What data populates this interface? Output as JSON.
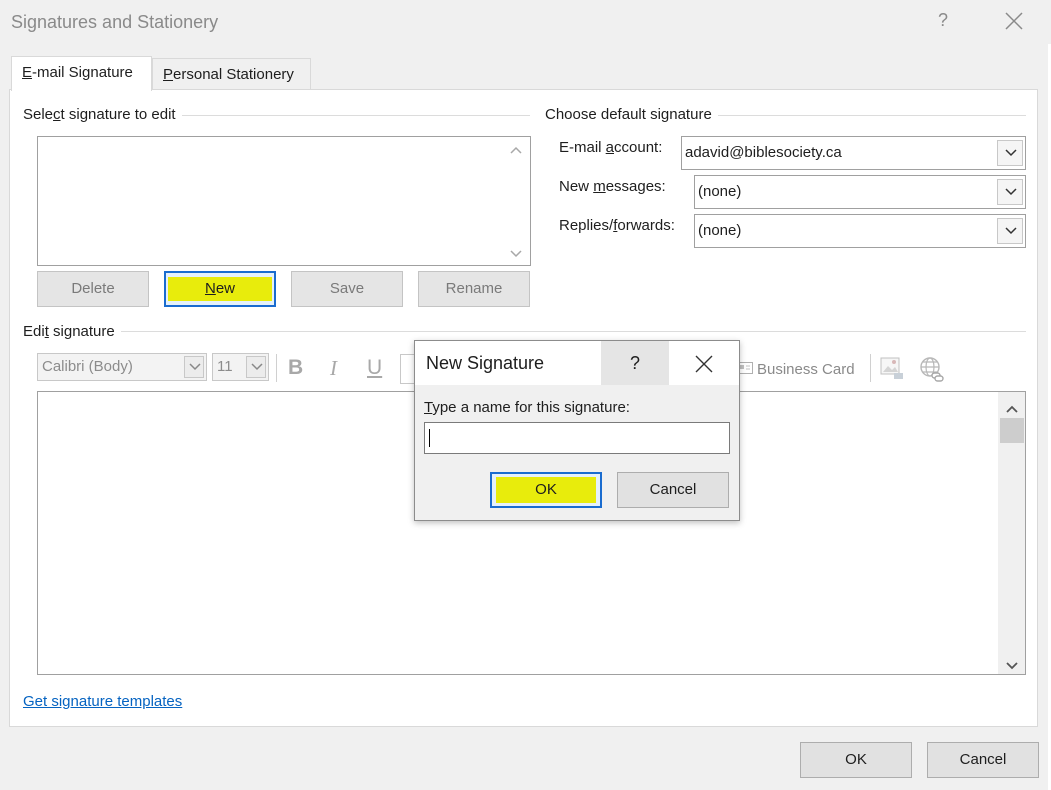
{
  "window": {
    "title": "Signatures and Stationery",
    "help": "?",
    "close_icon": "close-icon"
  },
  "tabs": [
    {
      "label": "E-mail Signature",
      "accel": "E",
      "rest": "-mail Signature",
      "active": true
    },
    {
      "label": "Personal Stationery",
      "accel": "P",
      "rest": "ersonal Stationery",
      "active": false
    }
  ],
  "select_section": {
    "label": "Select signature to edit",
    "label_pre": "Sele",
    "label_accel": "c",
    "label_post": "t signature to edit",
    "buttons": {
      "delete": "Delete",
      "new": {
        "label": "New",
        "accel": "N",
        "rest": "ew"
      },
      "save": "Save",
      "rename": "Rename"
    }
  },
  "default_section": {
    "label": "Choose default signature",
    "email_account": {
      "label": "E-mail account:",
      "pre": "E-mail ",
      "accel": "a",
      "post": "ccount:",
      "value": "adavid@biblesociety.ca"
    },
    "new_messages": {
      "label": "New messages:",
      "pre": "New ",
      "accel": "m",
      "post": "essages:",
      "value": "(none)"
    },
    "replies_forwards": {
      "label": "Replies/forwards:",
      "pre": "Replies/",
      "accel": "f",
      "post": "orwards:",
      "value": "(none)"
    }
  },
  "edit_section": {
    "label": "Edit signature",
    "label_pre": "Edi",
    "label_accel": "t",
    "label_post": " signature",
    "font": "Calibri (Body)",
    "size": "11",
    "bold": "B",
    "italic": "I",
    "underline": "U",
    "business_card": "Business Card"
  },
  "templates_link": "Get signature templates",
  "footer": {
    "ok": "OK",
    "cancel": "Cancel"
  },
  "dialog": {
    "title": "New Signature",
    "help": "?",
    "prompt": "Type a name for this signature:",
    "prompt_accel": "T",
    "prompt_rest": "ype a name for this signature:",
    "input_value": "",
    "ok": "OK",
    "cancel": "Cancel"
  },
  "colors": {
    "highlight": "#e8ec0c",
    "focus_border": "#1a6ccf",
    "link": "#0563c1"
  }
}
